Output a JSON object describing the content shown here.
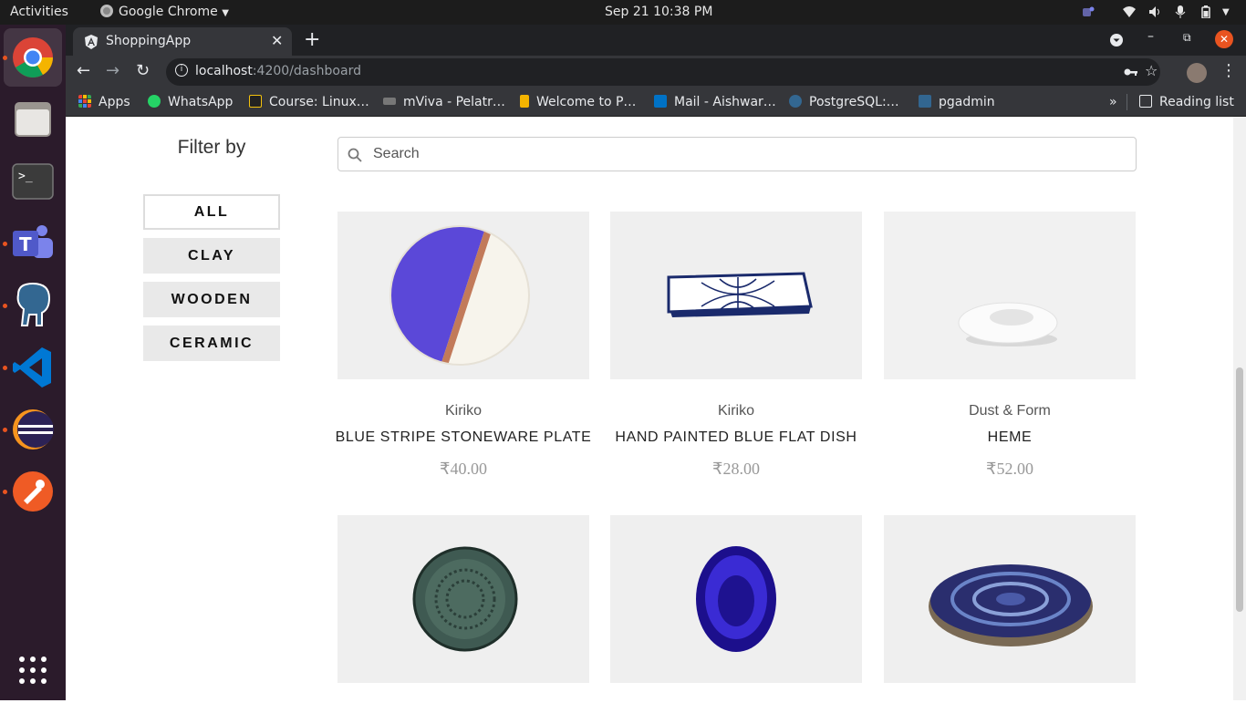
{
  "system": {
    "activities": "Activities",
    "app_menu": "Google Chrome",
    "clock": "Sep 21  10:38 PM"
  },
  "dock": {
    "apps": [
      "chrome-icon",
      "files-icon",
      "terminal-icon",
      "teams-icon",
      "postgres-elephant-icon",
      "vscode-icon",
      "eclipse-icon",
      "postman-icon"
    ],
    "show_apps": "app-grid-icon"
  },
  "browser": {
    "tab_title": "ShoppingApp",
    "url_host": "localhost",
    "url_path": ":4200/dashboard",
    "bookmarks": [
      {
        "label": "Apps",
        "color": "#ea4335"
      },
      {
        "label": "WhatsApp",
        "color": "#25d366"
      },
      {
        "label": "Course: Linux…",
        "color": "#f4c20d"
      },
      {
        "label": "mViva - Pelatr…",
        "color": "#aaaaaa"
      },
      {
        "label": "Welcome to P…",
        "color": "#f4b400"
      },
      {
        "label": "Mail - Aishwar…",
        "color": "#0072c6"
      },
      {
        "label": "PostgreSQL:…",
        "color": "#336791"
      },
      {
        "label": "pgadmin",
        "color": "#326690"
      }
    ],
    "reading_list": "Reading list",
    "more_bookmarks": "»"
  },
  "filter": {
    "title": "Filter by",
    "options": [
      {
        "label": "ALL",
        "active": true
      },
      {
        "label": "CLAY",
        "active": false
      },
      {
        "label": "WOODEN",
        "active": false
      },
      {
        "label": "CERAMIC",
        "active": false
      }
    ]
  },
  "search": {
    "placeholder": "Search"
  },
  "products": [
    {
      "brand": "Kiriko",
      "name": "BLUE STRIPE STONEWARE PLATE",
      "price": "₹40.00",
      "image": "purple-white-plate"
    },
    {
      "brand": "Kiriko",
      "name": "HAND PAINTED BLUE FLAT DISH",
      "price": "₹28.00",
      "image": "painted-flat-dish"
    },
    {
      "brand": "Dust & Form",
      "name": "HEME",
      "price": "₹52.00",
      "image": "white-ring-bowl"
    },
    {
      "brand": "",
      "name": "",
      "price": "",
      "image": "green-textured-plate"
    },
    {
      "brand": "",
      "name": "",
      "price": "",
      "image": "blue-oval-bowl"
    },
    {
      "brand": "",
      "name": "",
      "price": "",
      "image": "swirl-blue-plate"
    }
  ]
}
